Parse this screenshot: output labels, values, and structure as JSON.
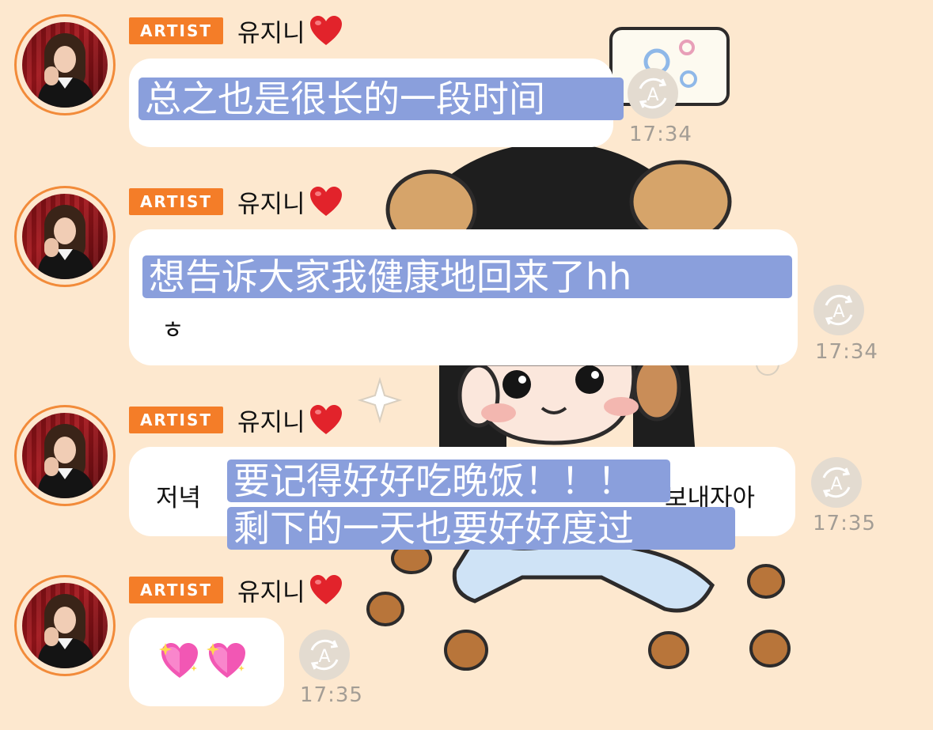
{
  "author": {
    "badge": "ARTIST",
    "name": "유지니"
  },
  "messages": [
    {
      "overlay_text": "总之也是很长的一段时间",
      "time": "17:34"
    },
    {
      "overlay_text": "想告诉大家我健康地回来了hh",
      "original_text": "ㅎ",
      "time": "17:34"
    },
    {
      "original_left": "저녁",
      "original_right": "보내자아",
      "overlay_line1": "要记得好好吃晚饭！！！",
      "overlay_line2": "剩下的一天也要好好度过",
      "time": "17:35"
    },
    {
      "emoji": "💖💖",
      "time": "17:35"
    }
  ],
  "colors": {
    "background": "#fde8cf",
    "badge": "#f47d28",
    "avatar_ring": "#f28b3a",
    "overlay": "#8a9fdc",
    "timestamp": "#a39d95"
  },
  "icons": [
    "translate-icon",
    "heart-icon",
    "sparkling-heart-icon",
    "avatar"
  ]
}
